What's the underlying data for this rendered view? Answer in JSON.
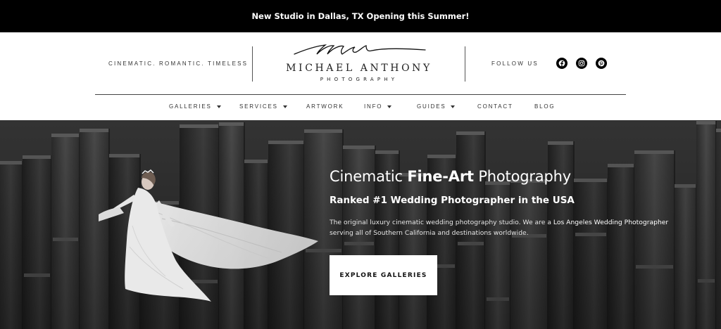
{
  "announcement": "New Studio in Dallas, TX Opening this Summer!",
  "header": {
    "tagline": "CINEMATIC. ROMANTIC. TIMELESS",
    "logo": {
      "script": "ma",
      "name": "MICHAEL ANTHONY",
      "sub": "PHOTOGRAPHY"
    },
    "follow_label": "FOLLOW US",
    "socials": [
      {
        "icon": "facebook-icon"
      },
      {
        "icon": "instagram-icon"
      },
      {
        "icon": "pinterest-icon"
      }
    ]
  },
  "nav": {
    "items": [
      {
        "label": "GALLERIES",
        "dropdown": true
      },
      {
        "label": "SERVICES",
        "dropdown": true
      },
      {
        "label": "ARTWORK",
        "dropdown": false
      },
      {
        "label": "INFO",
        "dropdown": true
      },
      {
        "label": "GUIDES",
        "dropdown": true
      },
      {
        "label": "CONTACT",
        "dropdown": false
      },
      {
        "label": "BLOG",
        "dropdown": false
      }
    ]
  },
  "hero": {
    "title_pre": "Cinematic ",
    "title_bold": "Fine-Art",
    "title_post": " Photography",
    "subtitle": "Ranked #1 Wedding Photographer in the USA",
    "body_pre": "The original luxury cinematic wedding photography studio. We are a ",
    "body_link": "Los Angeles Wedding Photographer",
    "body_post": " serving all of Southern California and destinations worldwide.",
    "cta": "EXPLORE GALLERIES"
  },
  "colors": {
    "announcement_bg": "#000000",
    "text_dark": "#333333",
    "hero_bg": "#3c3c3c",
    "white": "#ffffff"
  }
}
